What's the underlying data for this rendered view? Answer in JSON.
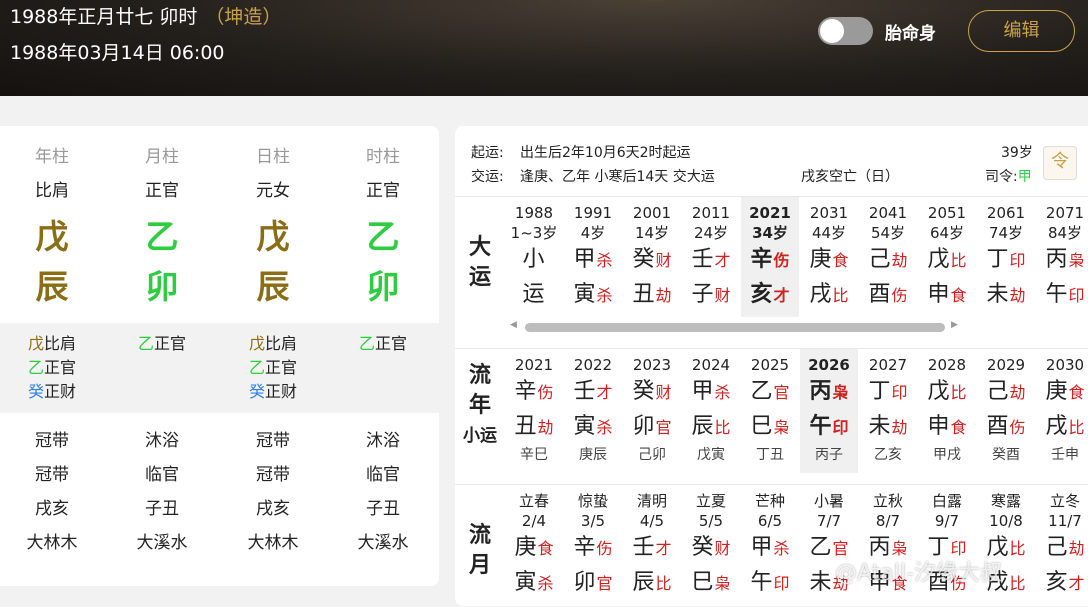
{
  "header": {
    "lunar_date": "1988年正月廿七 卯时",
    "gender": "（坤造）",
    "solar_date": "1988年03月14日 06:00",
    "toggle_label": "胎命身",
    "edit_label": "编辑"
  },
  "pillars": [
    {
      "name": "年柱",
      "shishen": "比肩",
      "gan": "戊",
      "zhi": "辰",
      "hidden": [
        {
          "g": "戊",
          "s": "比肩",
          "e": "earth"
        },
        {
          "g": "乙",
          "s": "正官",
          "e": "wood"
        },
        {
          "g": "癸",
          "s": "正财",
          "e": "water"
        }
      ],
      "xingyun": "冠带",
      "zizuo": "冠带",
      "kongwang": "戌亥",
      "nayin": "大林木",
      "gan_e": "earth",
      "zhi_e": "earth"
    },
    {
      "name": "月柱",
      "shishen": "正官",
      "gan": "乙",
      "zhi": "卯",
      "hidden": [
        {
          "g": "乙",
          "s": "正官",
          "e": "wood"
        }
      ],
      "xingyun": "沐浴",
      "zizuo": "临官",
      "kongwang": "子丑",
      "nayin": "大溪水",
      "gan_e": "wood",
      "zhi_e": "wood"
    },
    {
      "name": "日柱",
      "shishen": "元女",
      "gan": "戊",
      "zhi": "辰",
      "hidden": [
        {
          "g": "戊",
          "s": "比肩",
          "e": "earth"
        },
        {
          "g": "乙",
          "s": "正官",
          "e": "wood"
        },
        {
          "g": "癸",
          "s": "正财",
          "e": "water"
        }
      ],
      "xingyun": "冠带",
      "zizuo": "冠带",
      "kongwang": "戌亥",
      "nayin": "大林木",
      "gan_e": "earth",
      "zhi_e": "earth"
    },
    {
      "name": "时柱",
      "shishen": "正官",
      "gan": "乙",
      "zhi": "卯",
      "hidden": [
        {
          "g": "乙",
          "s": "正官",
          "e": "wood"
        }
      ],
      "xingyun": "沐浴",
      "zizuo": "临官",
      "kongwang": "子丑",
      "nayin": "大溪水",
      "gan_e": "wood",
      "zhi_e": "wood"
    }
  ],
  "info": {
    "qiyun_label": "起运:",
    "qiyun_text": "出生后2年10月6天2时起运",
    "age": "39岁",
    "jiaoyun_label": "交运:",
    "jiaoyun_text": "逢庚、乙年 小寒后14天 交大运",
    "kongwang": "戌亥空亡（日）",
    "siling_label": "司令:",
    "siling_value": "甲"
  },
  "dayun_label": [
    "大",
    "运"
  ],
  "dayun": [
    {
      "year": "1988",
      "age": "1~3岁",
      "g": "小",
      "gt": "",
      "z": "运",
      "zt": ""
    },
    {
      "year": "1991",
      "age": "4岁",
      "g": "甲",
      "gt": "杀",
      "z": "寅",
      "zt": "杀"
    },
    {
      "year": "2001",
      "age": "14岁",
      "g": "癸",
      "gt": "财",
      "z": "丑",
      "zt": "劫"
    },
    {
      "year": "2011",
      "age": "24岁",
      "g": "壬",
      "gt": "才",
      "z": "子",
      "zt": "财"
    },
    {
      "year": "2021",
      "age": "34岁",
      "g": "辛",
      "gt": "伤",
      "z": "亥",
      "zt": "才",
      "sel": true
    },
    {
      "year": "2031",
      "age": "44岁",
      "g": "庚",
      "gt": "食",
      "z": "戌",
      "zt": "比"
    },
    {
      "year": "2041",
      "age": "54岁",
      "g": "己",
      "gt": "劫",
      "z": "酉",
      "zt": "伤"
    },
    {
      "year": "2051",
      "age": "64岁",
      "g": "戊",
      "gt": "比",
      "z": "申",
      "zt": "食"
    },
    {
      "year": "2061",
      "age": "74岁",
      "g": "丁",
      "gt": "印",
      "z": "未",
      "zt": "劫"
    },
    {
      "year": "2071",
      "age": "84岁",
      "g": "丙",
      "gt": "枭",
      "z": "午",
      "zt": "印"
    }
  ],
  "liunian_label": [
    "流",
    "年"
  ],
  "xiaoyun_label": "小运",
  "liunian": [
    {
      "year": "2021",
      "g": "辛",
      "gt": "伤",
      "z": "丑",
      "zt": "劫",
      "sub": "辛巳"
    },
    {
      "year": "2022",
      "g": "壬",
      "gt": "才",
      "z": "寅",
      "zt": "杀",
      "sub": "庚辰"
    },
    {
      "year": "2023",
      "g": "癸",
      "gt": "财",
      "z": "卯",
      "zt": "官",
      "sub": "己卯"
    },
    {
      "year": "2024",
      "g": "甲",
      "gt": "杀",
      "z": "辰",
      "zt": "比",
      "sub": "戊寅"
    },
    {
      "year": "2025",
      "g": "乙",
      "gt": "官",
      "z": "巳",
      "zt": "枭",
      "sub": "丁丑"
    },
    {
      "year": "2026",
      "g": "丙",
      "gt": "枭",
      "z": "午",
      "zt": "印",
      "sub": "丙子",
      "sel": true
    },
    {
      "year": "2027",
      "g": "丁",
      "gt": "印",
      "z": "未",
      "zt": "劫",
      "sub": "乙亥"
    },
    {
      "year": "2028",
      "g": "戊",
      "gt": "比",
      "z": "申",
      "zt": "食",
      "sub": "甲戌"
    },
    {
      "year": "2029",
      "g": "己",
      "gt": "劫",
      "z": "酉",
      "zt": "伤",
      "sub": "癸酉"
    },
    {
      "year": "2030",
      "g": "庚",
      "gt": "食",
      "z": "戌",
      "zt": "比",
      "sub": "壬申"
    }
  ],
  "liuyue_label": [
    "流",
    "月"
  ],
  "liuyue": [
    {
      "term": "立春",
      "date": "2/4",
      "g": "庚",
      "gt": "食",
      "z": "寅",
      "zt": "杀"
    },
    {
      "term": "惊蛰",
      "date": "3/5",
      "g": "辛",
      "gt": "伤",
      "z": "卯",
      "zt": "官"
    },
    {
      "term": "清明",
      "date": "4/5",
      "g": "壬",
      "gt": "才",
      "z": "辰",
      "zt": "比"
    },
    {
      "term": "立夏",
      "date": "5/5",
      "g": "癸",
      "gt": "财",
      "z": "巳",
      "zt": "枭"
    },
    {
      "term": "芒种",
      "date": "6/5",
      "g": "甲",
      "gt": "杀",
      "z": "午",
      "zt": "印"
    },
    {
      "term": "小暑",
      "date": "7/7",
      "g": "乙",
      "gt": "官",
      "z": "未",
      "zt": "劫"
    },
    {
      "term": "立秋",
      "date": "8/7",
      "g": "丙",
      "gt": "枭",
      "z": "申",
      "zt": "食"
    },
    {
      "term": "白露",
      "date": "9/7",
      "g": "丁",
      "gt": "印",
      "z": "酉",
      "zt": "伤"
    },
    {
      "term": "寒露",
      "date": "10/8",
      "g": "戊",
      "gt": "比",
      "z": "戌",
      "zt": "比"
    },
    {
      "term": "立冬",
      "date": "11/7",
      "g": "己",
      "gt": "劫",
      "z": "亥",
      "zt": "才"
    }
  ],
  "watermark": "@Atall-汐缘大叔",
  "colors": {
    "earth": "#8a6d14",
    "wood": "#2ecc40",
    "water": "#2f7fe8",
    "accent": "#c9a24a",
    "ten_god": "#d02020"
  }
}
